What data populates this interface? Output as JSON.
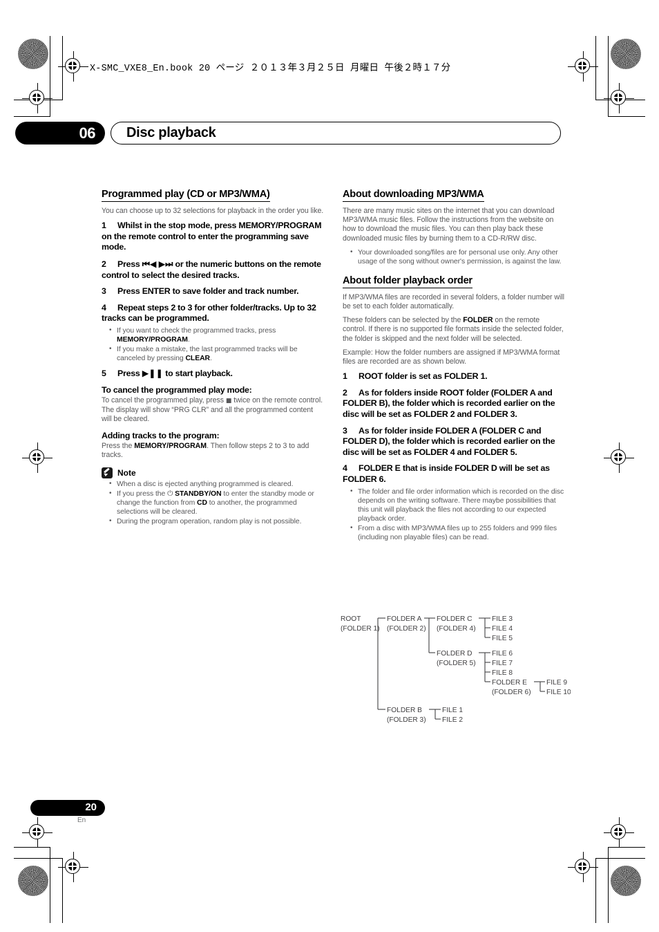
{
  "header": {
    "book_line": "X-SMC_VXE8_En.book   20 ページ   ２０１３年３月２５日   月曜日   午後２時１７分"
  },
  "chapter": {
    "number": "06",
    "title": "Disc playback"
  },
  "footer": {
    "page_number": "20",
    "language_code": "En"
  },
  "left_column": {
    "section_title": "Programmed play (CD or MP3/WMA)",
    "intro": "You can choose up to 32 selections for playback in the order you like.",
    "step1_num": "1",
    "step1_text": "Whilst in the stop mode, press MEMORY/PROGRAM on the remote control to enter the programming save mode.",
    "step2_num": "2",
    "step2_a": "Press",
    "step2_b": "or the numeric buttons on the remote control to select the desired tracks.",
    "step3_num": "3",
    "step3_text": "Press ENTER to save folder and track number.",
    "step4_num": "4",
    "step4_text": "Repeat steps 2 to 3 for other folder/tracks. Up to 32 tracks can be programmed.",
    "step4_bullets": [
      {
        "pre": "If you want to check the programmed tracks, press ",
        "kw": "MEMORY/PROGRAM",
        "post": "."
      },
      {
        "pre": "If you make a mistake, the last programmed tracks will be canceled by pressing ",
        "kw": "CLEAR",
        "post": "."
      }
    ],
    "step5_num": "5",
    "step5_a": "Press",
    "step5_b": "to start playback.",
    "cancel_heading": "To cancel the programmed play mode:",
    "cancel_body_a": "To cancel the programmed play, press",
    "cancel_body_b": "twice on the remote control. The display will show “PRG CLR” and all the programmed content will be cleared.",
    "adding_heading": "Adding tracks to the program:",
    "adding_pre": "Press the ",
    "adding_kw": "MEMORY/PROGRAM",
    "adding_post": ". Then follow steps 2 to 3 to add tracks.",
    "note_label": "Note",
    "note_bullets": [
      {
        "pre": "When a disc is ejected anything programmed is cleared.",
        "kw": "",
        "post": ""
      },
      {
        "pre": "If you press the ⏻ ",
        "kw": "STANDBY/ON",
        "mid": " to enter the standby mode or change the function from ",
        "kw2": "CD",
        "post": " to another, the programmed selections will be cleared."
      },
      {
        "pre": "During the program operation, random play is not possible.",
        "kw": "",
        "post": ""
      }
    ]
  },
  "right_column": {
    "download_title": "About downloading MP3/WMA",
    "download_body": "There are many music sites on the internet that you can download MP3/WMA music files. Follow the instructions from the website on how to download the music files. You can then play back these downloaded music files by burning them to a CD-R/RW disc.",
    "download_bullets": [
      "Your downloaded song/files are for personal use only. Any other usage of the song without owner's permission, is against the law."
    ],
    "folder_title": "About folder playback order",
    "folder_p1": "If MP3/WMA files are recorded in several folders, a folder number will be set to each folder automatically.",
    "folder_p2_pre": "These folders can be selected by the ",
    "folder_p2_kw": "FOLDER",
    "folder_p2_post": " on the remote control. If there is no supported file formats inside the selected folder, the folder is skipped and the next folder will be selected.",
    "folder_p3": "Example: How the folder numbers are assigned if MP3/WMA format files are recorded are as shown below.",
    "step1_num": "1",
    "step1_text": "ROOT folder is set as FOLDER 1.",
    "step2_num": "2",
    "step2_text": "As for folders inside ROOT folder (FOLDER A and FOLDER B), the folder which is recorded earlier on the disc will be set as FOLDER 2 and FOLDER 3.",
    "step3_num": "3",
    "step3_text": "As for folder inside FOLDER A (FOLDER C and FOLDER D), the folder which is recorded earlier on the disc will be set as FOLDER 4 and FOLDER 5.",
    "step4_num": "4",
    "step4_text": "FOLDER E that is inside FOLDER D will be set as FOLDER 6.",
    "step4_bullets": [
      "The folder and file order information which is recorded on the disc depends on the writing software. There maybe possibilities that this unit will playback the files not according to our expected playback order.",
      "From a disc with MP3/WMA files up to 255 folders and 999 files (including non playable files) can be read."
    ]
  },
  "tree": {
    "root_name": "ROOT",
    "root_num": "(FOLDER 1)",
    "folder_a_name": "FOLDER A",
    "folder_a_num": "(FOLDER 2)",
    "folder_b_name": "FOLDER B",
    "folder_b_num": "(FOLDER 3)",
    "folder_c_name": "FOLDER C",
    "folder_c_num": "(FOLDER 4)",
    "folder_d_name": "FOLDER D",
    "folder_d_num": "(FOLDER 5)",
    "folder_e_name": "FOLDER E",
    "folder_e_num": "(FOLDER 6)",
    "file1": "FILE 1",
    "file2": "FILE 2",
    "file3": "FILE 3",
    "file4": "FILE 4",
    "file5": "FILE 5",
    "file6": "FILE 6",
    "file7": "FILE 7",
    "file8": "FILE 8",
    "file9": "FILE 9",
    "file10": "FILE 10"
  },
  "colors": {
    "ink": "#000000",
    "body_gray": "#58585a",
    "diagram_gray": "#414042"
  }
}
